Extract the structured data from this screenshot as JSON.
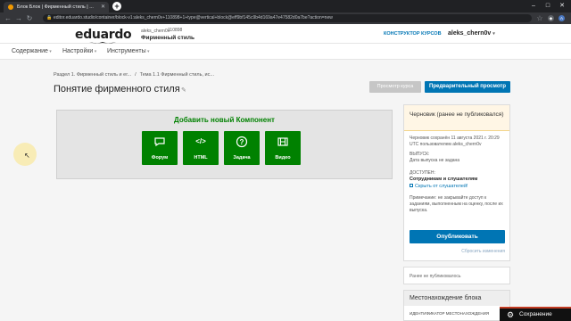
{
  "browser": {
    "tab_title": "Блок Блок | Фирменный стиль | ...",
    "url": "editor.eduardo.studio/container/block-v1:aleks_chern0v+110898+1+type@vertical+block@eff9bf145c9b4d169a47e47582d0a7be?action=new",
    "profile_initial": "A"
  },
  "header": {
    "logo": "eduardo",
    "org": "aleks_chern0v",
    "course_number": "110898",
    "course_title": "Фирменный стиль",
    "constructor_link": "КОНСТРУКТОР КУРСОВ",
    "username": "aleks_chern0v"
  },
  "nav": {
    "items": [
      "Содержание",
      "Настройки",
      "Инструменты"
    ]
  },
  "breadcrumb": {
    "section": "Раздел 1. Фирменный стиль и ег...",
    "subsection": "Тема 1.1 Фирменный стиль, ис..."
  },
  "page": {
    "title": "Понятие фирменного стиля",
    "preview_course_btn": "Просмотр курса",
    "preview_btn": "Предварительный просмотр"
  },
  "components": {
    "title": "Добавить новый Компонент",
    "buttons": [
      {
        "label": "Форум",
        "icon": "chat-icon",
        "glyph": "💬"
      },
      {
        "label": "HTML",
        "icon": "code-icon",
        "glyph": "</>"
      },
      {
        "label": "Задача",
        "icon": "question-icon",
        "glyph": "?"
      },
      {
        "label": "Видео",
        "icon": "film-icon",
        "glyph": "🎞"
      }
    ]
  },
  "sidebar": {
    "status_title": "Черновик (ранее не публиковался)",
    "saved_note": "Черновик сохранён 11 августа 2021 г. 20:29 UTC пользователем aleks_chern0v",
    "release_label": "ВЫПУСК:",
    "release_value": "Дата выпуска не задана",
    "access_label": "ДОСТУПЕН:",
    "access_value": "Сотрудникам и слушателям",
    "hide_link": "Скрыть от слушателей!",
    "note": "Примечание: не закрывайте доступ к заданиям, выполненным на оценку, после их выпуска.",
    "publish_btn": "Опубликовать",
    "discard_link": "Сбросить изменения",
    "never_published": "Ранее не публиковалось",
    "location_title": "Местонахождение блока",
    "location_sub": "ИДЕНТИФИКАТОР МЕСТОНАХОЖДЕНИЯ"
  },
  "toast": {
    "label": "Сохранение"
  },
  "colors": {
    "accent_blue": "#0075b4",
    "component_green": "#008100",
    "draft_bg": "#fff6e5"
  }
}
